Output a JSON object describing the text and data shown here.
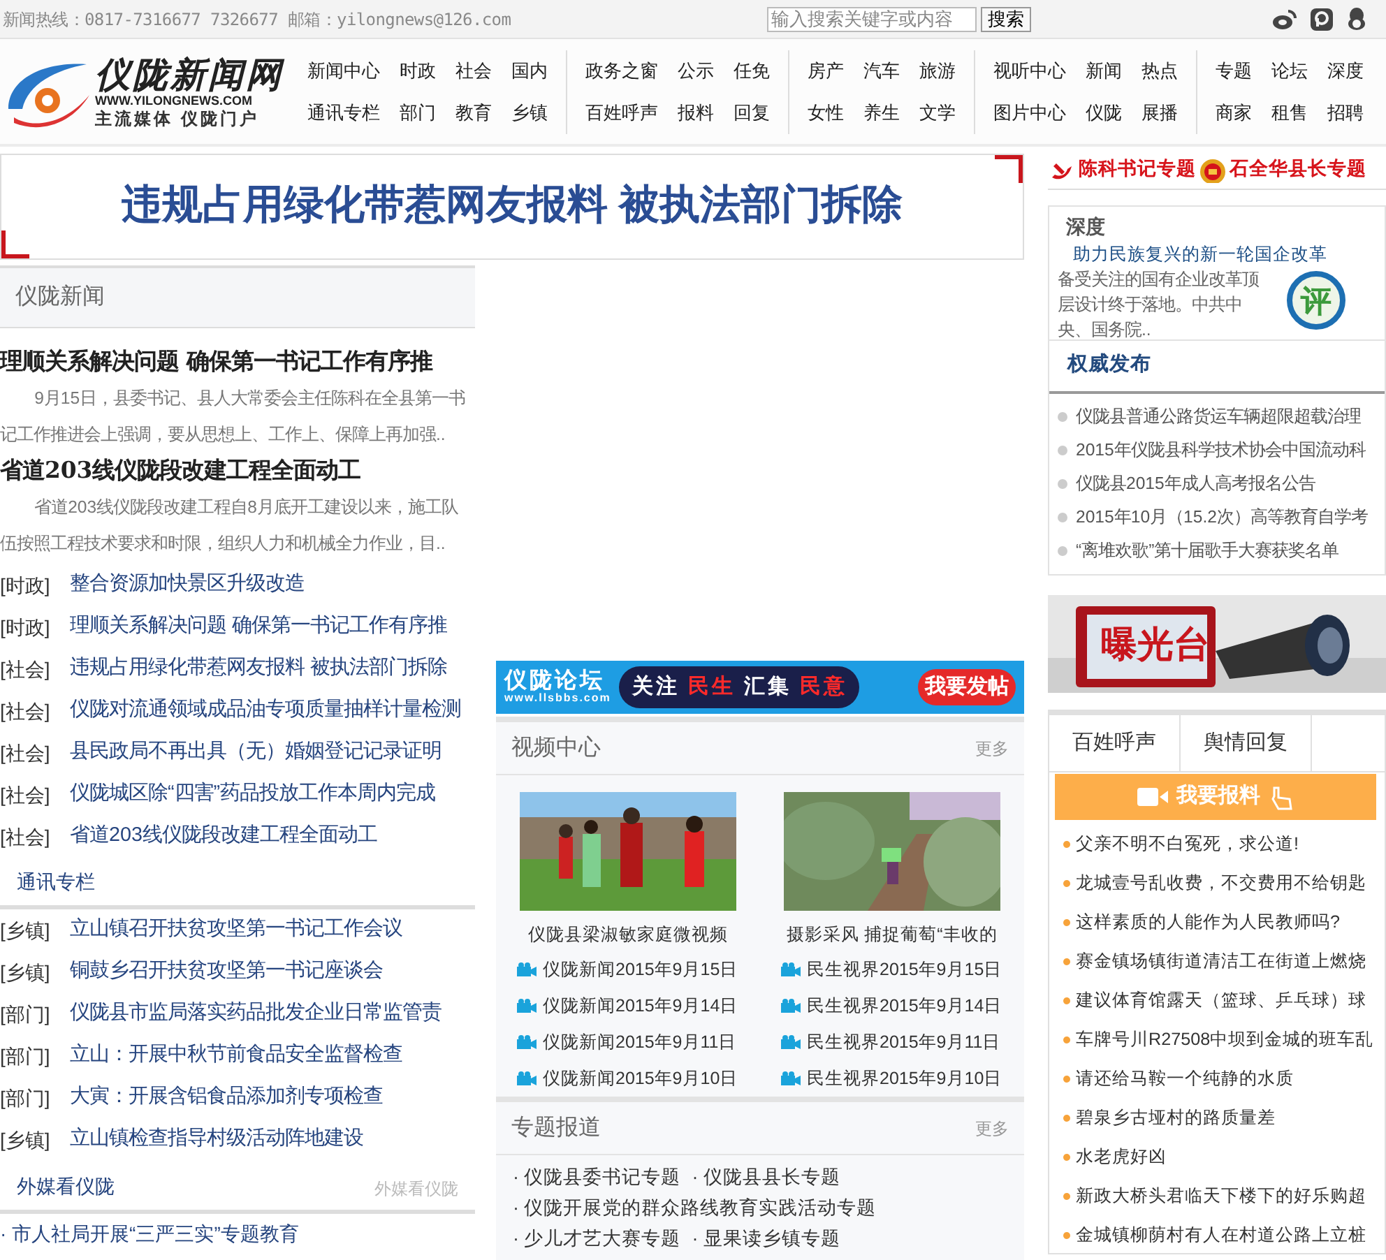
{
  "top_bar": {
    "hotline": "新闻热线：0817-7316677 7326677 邮箱：yilongnews@126.com",
    "search": {
      "placeholder": "输入搜索关键字或内容",
      "button": "搜索"
    }
  },
  "logo": {
    "title": "仪陇新闻网",
    "url": "WWW.YILONGNEWS.COM",
    "slogan": "主流媒体 仪陇门户"
  },
  "nav_groups": [
    {
      "rows": [
        [
          "新闻中心",
          "时政",
          "社会",
          "国内"
        ],
        [
          "通讯专栏",
          "部门",
          "教育",
          "乡镇"
        ]
      ]
    },
    {
      "rows": [
        [
          "政务之窗",
          "公示",
          "任免"
        ],
        [
          "百姓呼声",
          "报料",
          "回复"
        ]
      ]
    },
    {
      "rows": [
        [
          "房产",
          "汽车",
          "旅游"
        ],
        [
          "女性",
          "养生",
          "文学"
        ]
      ]
    },
    {
      "rows": [
        [
          "视听中心",
          "新闻",
          "热点"
        ],
        [
          "图片中心",
          "仪陇",
          "展播"
        ]
      ]
    },
    {
      "rows": [
        [
          "专题",
          "论坛",
          "深度"
        ],
        [
          "商家",
          "租售",
          "招聘"
        ]
      ]
    }
  ],
  "headline_banner": "违规占用绿化带惹网友报料 被执法部门拆除",
  "news": {
    "title": "仪陇新闻",
    "features": [
      {
        "title": "理顺关系解决问题  确保第一书记工作有序推",
        "summary": "9月15日，县委书记、县人大常委会主任陈科在全县第一书记工作推进会上强调，要从思想上、工作上、保障上再加强.."
      },
      {
        "title": "省道203线仪陇段改建工程全面动工",
        "summary": "省道203线仪陇段改建工程自8月底开工建设以来，施工队伍按照工程技术要求和时限，组织人力和机械全力作业，目.."
      }
    ],
    "items": [
      {
        "tag": "[时政]",
        "title": "整合资源加快景区升级改造"
      },
      {
        "tag": "[时政]",
        "title": "理顺关系解决问题  确保第一书记工作有序推"
      },
      {
        "tag": "[社会]",
        "title": "违规占用绿化带惹网友报料  被执法部门拆除"
      },
      {
        "tag": "[社会]",
        "title": "仪陇对流通领域成品油专项质量抽样计量检测"
      },
      {
        "tag": "[社会]",
        "title": "县民政局不再出具（无）婚姻登记记录证明"
      },
      {
        "tag": "[社会]",
        "title": "仪陇城区除“四害”药品投放工作本周内完成"
      },
      {
        "tag": "[社会]",
        "title": "省道203线仪陇段改建工程全面动工"
      }
    ]
  },
  "column": {
    "title": "通讯专栏",
    "items": [
      {
        "tag": "[乡镇]",
        "title": "立山镇召开扶贫攻坚第一书记工作会议"
      },
      {
        "tag": "[乡镇]",
        "title": "铜鼓乡召开扶贫攻坚第一书记座谈会"
      },
      {
        "tag": "[部门]",
        "title": "仪陇县市监局落实药品批发企业日常监管责"
      },
      {
        "tag": "[部门]",
        "title": "立山：开展中秋节前食品安全监督检查"
      },
      {
        "tag": "[部门]",
        "title": "大寅：开展含铝食品添加剂专项检查"
      },
      {
        "tag": "[乡镇]",
        "title": "立山镇检查指导村级活动阵地建设"
      }
    ]
  },
  "foreign_media": {
    "title": "外媒看仪陇",
    "more": "外媒看仪陇",
    "items": [
      "· 市人社局开展“三严三实”专题教育"
    ]
  },
  "forum_banner": {
    "name": "仪陇论坛",
    "url": "www.llsbbs.com",
    "slogan": [
      {
        "text": "关注",
        "accent": false
      },
      {
        "text": "民生",
        "accent": true
      },
      {
        "text": "汇集",
        "accent": false
      },
      {
        "text": "民意",
        "accent": true
      }
    ],
    "button": "我要发帖"
  },
  "video_center": {
    "title": "视频中心",
    "more": "更多",
    "videos": [
      {
        "caption": "仪陇县梁淑敏家庭微视频",
        "items": [
          "仪陇新闻2015年9月15日",
          "仪陇新闻2015年9月14日",
          "仪陇新闻2015年9月11日",
          "仪陇新闻2015年9月10日"
        ]
      },
      {
        "caption": "摄影采风 捕捉葡萄“丰收的",
        "items": [
          "民生视界2015年9月15日",
          "民生视界2015年9月14日",
          "民生视界2015年9月11日",
          "民生视界2015年9月10日"
        ]
      }
    ]
  },
  "topics": {
    "title": "专题报道",
    "more": "更多",
    "rows": [
      [
        "· 仪陇县委书记专题",
        "· 仪陇县县长专题"
      ],
      [
        "· 仪陇开展党的群众路线教育实践活动专题"
      ],
      [
        "· 少儿才艺大赛专题",
        "· 显果读乡镇专题"
      ]
    ]
  },
  "special_links": [
    {
      "label": "陈科书记专题"
    },
    {
      "label": "石全华县长专题"
    }
  ],
  "depth": {
    "title": "深度",
    "headline": "助力民族复兴的新一轮国企改革",
    "summary": "备受关注的国有企业改革顶层设计终于落地。中共中央、国务院..",
    "badge": "评"
  },
  "authority": {
    "title": "权威发布",
    "items": [
      "仪陇县普通公路货运车辆超限超载治理",
      "2015年仪陇县科学技术协会中国流动科",
      "仪陇县2015年成人高考报名公告",
      "2015年10月（15.2次）高等教育自学考",
      "“离堆欢歌”第十届歌手大赛获奖名单"
    ]
  },
  "exposure": {
    "label": "曝光台"
  },
  "complaint_tabs": [
    "百姓呼声",
    "舆情回复"
  ],
  "report_button": "我要报料",
  "complaints": [
    "父亲不明不白冤死，求公道!",
    "龙城壹号乱收费，不交费用不给钥匙",
    "这样素质的人能作为人民教师吗?",
    "赛金镇场镇街道清洁工在街道上燃烧",
    "建议体育馆露天（篮球、乒乓球）球",
    "车牌号川R27508中坝到金城的班车乱",
    "请还给马鞍一个纯静的水质",
    "碧泉乡古垭村的路质量差",
    "水老虎好凶",
    "新政大桥头君临天下楼下的好乐购超",
    "金城镇柳荫村有人在村道公路上立桩"
  ]
}
